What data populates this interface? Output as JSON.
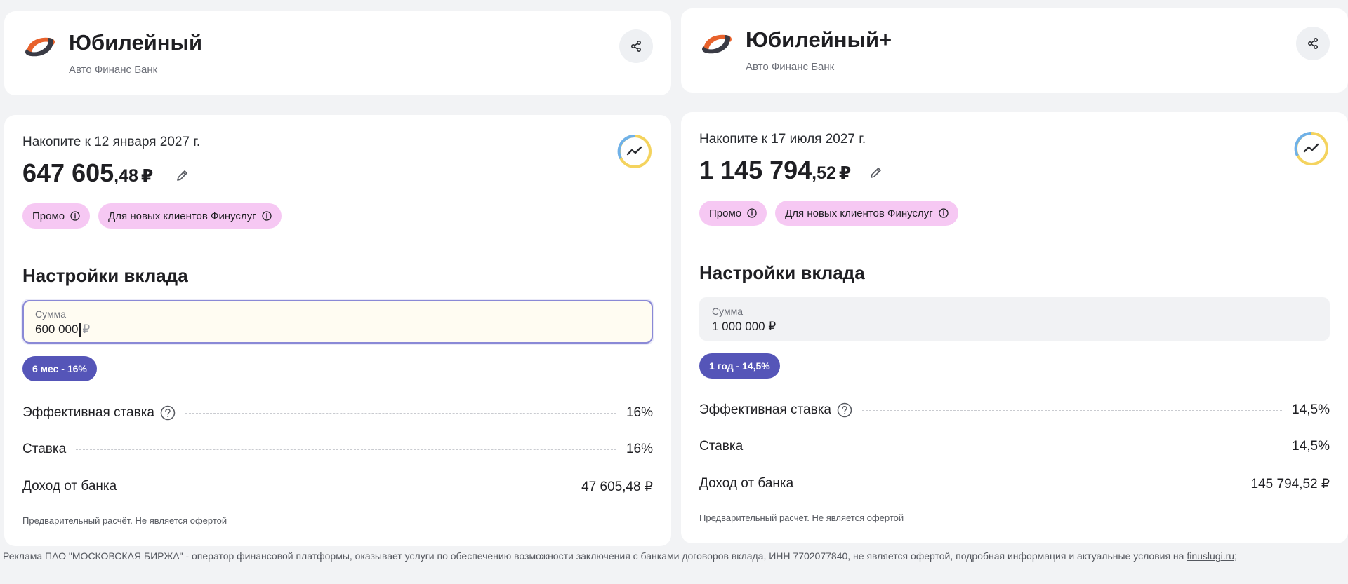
{
  "colors": {
    "page_bg": "#f2f3f5",
    "card_bg": "#ffffff",
    "badge_pink": "#f6c8f3",
    "chip_purple": "#5555b8",
    "logo_orange": "#e8622c",
    "logo_dark": "#3a3b45",
    "ring_yellow": "#f4d35e",
    "ring_blue": "#6fb1e8"
  },
  "offers": [
    {
      "bank_title": "Юбилейный",
      "bank_subtitle": "Авто Финанс Банк",
      "accumulate_label": "Накопите к 12 января 2027 г.",
      "amount_int": "647 605",
      "amount_frac": ",48",
      "amount_currency": "₽",
      "badges": [
        "Промо",
        "Для новых клиентов Финуслуг"
      ],
      "settings_title": "Настройки вклада",
      "sum_label": "Сумма",
      "sum_value": "600 000",
      "sum_currency": "₽",
      "term_chip": "6 мес - 16%",
      "rows": [
        {
          "label": "Эффективная ставка",
          "value": "16%"
        },
        {
          "label": "Ставка",
          "value": "16%"
        },
        {
          "label": "Доход от банка",
          "value": "47 605,48 ₽"
        }
      ],
      "disclaimer": "Предварительный расчёт. Не является офертой"
    },
    {
      "bank_title": "Юбилейный+",
      "bank_subtitle": "Авто Финанс Банк",
      "accumulate_label": "Накопите к 17 июля 2027 г.",
      "amount_int": "1 145 794",
      "amount_frac": ",52",
      "amount_currency": "₽",
      "badges": [
        "Промо",
        "Для новых клиентов Финуслуг"
      ],
      "settings_title": "Настройки вклада",
      "sum_label": "Сумма",
      "sum_value": "1 000 000 ₽",
      "term_chip": "1 год - 14,5%",
      "rows": [
        {
          "label": "Эффективная ставка",
          "value": "14,5%"
        },
        {
          "label": "Ставка",
          "value": "14,5%"
        },
        {
          "label": "Доход от банка",
          "value": "145 794,52 ₽"
        }
      ],
      "disclaimer": "Предварительный расчёт. Не является офертой"
    }
  ],
  "footer": {
    "text": "Реклама ПАО \"МОСКОВСКАЯ БИРЖА\" - оператор финансовой платформы, оказывает услуги по обеспечению возможности заключения с банками договоров вклада, ИНН 7702077840, не является офертой, подробная информация и актуальные условия на ",
    "link": "finuslugi.ru",
    "suffix": ";"
  }
}
